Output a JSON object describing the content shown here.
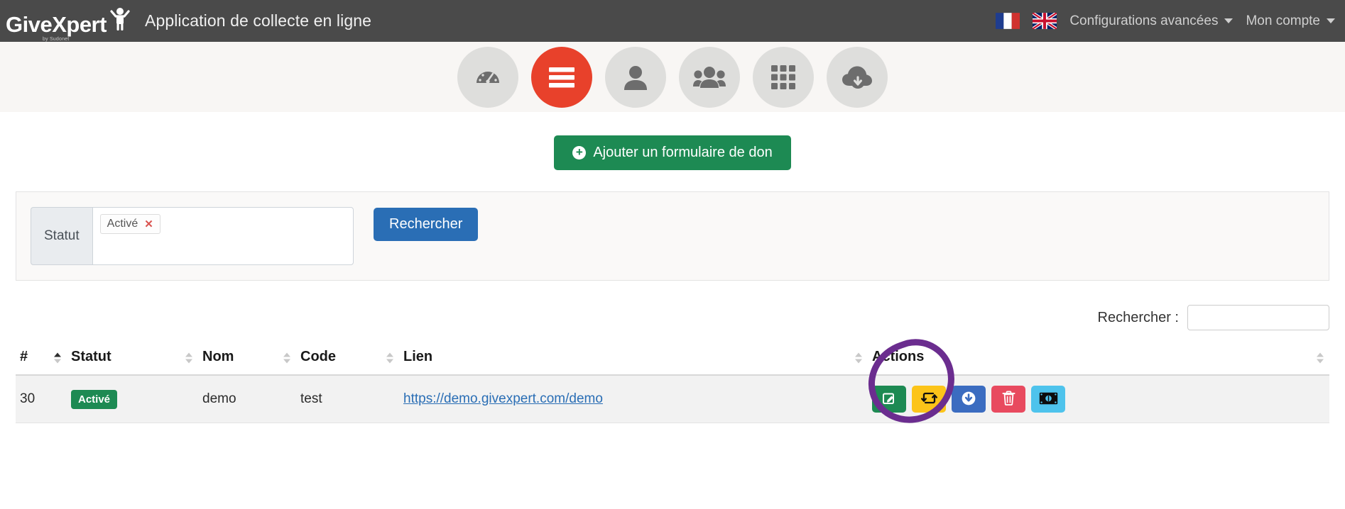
{
  "header": {
    "brand_name": "GiveXpert",
    "brand_sub": "by Sudonet",
    "brand_logo_icon": "person-raised-arms-icon",
    "app_title": "Application de collecte en ligne",
    "flags": [
      {
        "name": "flag-fr-icon",
        "label": "Français"
      },
      {
        "name": "flag-en-icon",
        "label": "English"
      }
    ],
    "nav": [
      {
        "label": "Configurations avancées",
        "name": "nav-advanced-config"
      },
      {
        "label": "Mon compte",
        "name": "nav-my-account"
      }
    ]
  },
  "iconbar": {
    "items": [
      {
        "icon": "gauge-dashboard-icon",
        "active": false
      },
      {
        "icon": "hamburger-menu-icon",
        "active": true
      },
      {
        "icon": "user-icon",
        "active": false
      },
      {
        "icon": "users-group-icon",
        "active": false
      },
      {
        "icon": "grid-apps-icon",
        "active": false
      },
      {
        "icon": "cloud-download-icon",
        "active": false
      }
    ],
    "active_color": "#e8412b",
    "inactive_color": "#dededc"
  },
  "main": {
    "add_button": {
      "label": "Ajouter un formulaire de don",
      "icon": "plus-circle-icon",
      "color": "#1d8a53"
    },
    "filter": {
      "status_label": "Statut",
      "tags": [
        {
          "label": "Activé",
          "remove_icon": "remove-tag-icon"
        }
      ],
      "search_button": {
        "label": "Rechercher",
        "color": "#2a6eb5"
      }
    },
    "table_search": {
      "label": "Rechercher :",
      "value": "",
      "placeholder": ""
    },
    "table": {
      "columns": [
        {
          "label": "#",
          "sort": "asc"
        },
        {
          "label": "Statut",
          "sort": "none"
        },
        {
          "label": "Nom",
          "sort": "none"
        },
        {
          "label": "Code",
          "sort": "none"
        },
        {
          "label": "Lien",
          "sort": "none"
        },
        {
          "label": "Actions",
          "sort": "none"
        }
      ],
      "rows": [
        {
          "id": "30",
          "status": "Activé",
          "status_color": "#1d8a53",
          "nom": "demo",
          "code": "test",
          "lien": "https://demo.givexpert.com/demo",
          "actions": [
            {
              "name": "edit-form-button",
              "icon": "pencil-square-icon",
              "color": "#1d8a53"
            },
            {
              "name": "duplicate-form-button",
              "icon": "retweet-duplicate-icon",
              "color": "#fcc419"
            },
            {
              "name": "download-form-button",
              "icon": "download-circle-icon",
              "color": "#3b6cc0"
            },
            {
              "name": "delete-form-button",
              "icon": "trash-icon",
              "color": "#e84a5f"
            },
            {
              "name": "donations-button",
              "icon": "banknote-money-icon",
              "color": "#4ec3ec"
            }
          ]
        }
      ]
    },
    "annotation": {
      "shape": "hand-drawn-circle",
      "color": "#6b2d8f",
      "target": "duplicate-form-button"
    }
  }
}
